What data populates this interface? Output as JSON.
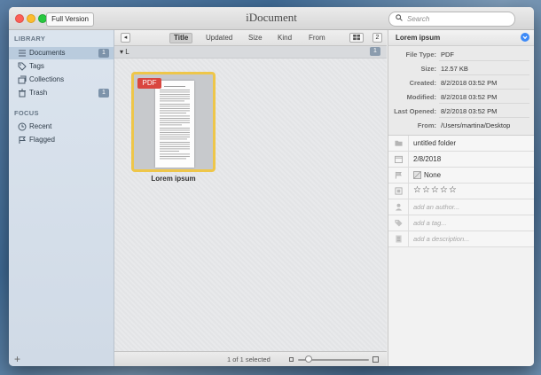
{
  "window": {
    "title": "iDocument",
    "full_version_label": "Full Version"
  },
  "search": {
    "placeholder": "Search"
  },
  "sidebar": {
    "library_header": "LIBRARY",
    "items": [
      {
        "label": "Documents",
        "badge": "1"
      },
      {
        "label": "Tags",
        "badge": ""
      },
      {
        "label": "Collections",
        "badge": ""
      },
      {
        "label": "Trash",
        "badge": "1"
      }
    ],
    "focus_header": "FOCUS",
    "focus_items": [
      {
        "label": "Recent"
      },
      {
        "label": "Flagged"
      }
    ],
    "add_label": "+"
  },
  "toolbar": {
    "back_label": "◂",
    "sort_tabs": [
      "Title",
      "Updated",
      "Size",
      "Kind",
      "From"
    ],
    "active_tab": "Title",
    "count_label": "2"
  },
  "group": {
    "label": "▾ L",
    "count": "1"
  },
  "document": {
    "name": "Lorem ipsum",
    "badge": "PDF"
  },
  "status": {
    "selection": "1 of 1 selected",
    "zoom_level": 0.15
  },
  "inspector": {
    "title": "Lorem ipsum",
    "metadata": [
      {
        "key": "File Type:",
        "value": "PDF"
      },
      {
        "key": "Size:",
        "value": "12.57 KB"
      },
      {
        "key": "Created:",
        "value": "8/2/2018 03:52 PM"
      },
      {
        "key": "Modified:",
        "value": "8/2/2018 03:52 PM"
      },
      {
        "key": "Last Opened:",
        "value": "8/2/2018 03:52 PM"
      },
      {
        "key": "From:",
        "value": "/Users/martina/Desktop"
      }
    ],
    "properties": {
      "folder": "untitled folder",
      "date": "2/8/2018",
      "flag": "None",
      "rating": "☆☆☆☆☆",
      "author_placeholder": "add an author...",
      "tag_placeholder": "add a tag...",
      "description_placeholder": "add a description..."
    }
  },
  "colors": {
    "accent": "#3d8af7",
    "pdf_red": "#d9463f",
    "thumb_border": "#eec64a"
  }
}
